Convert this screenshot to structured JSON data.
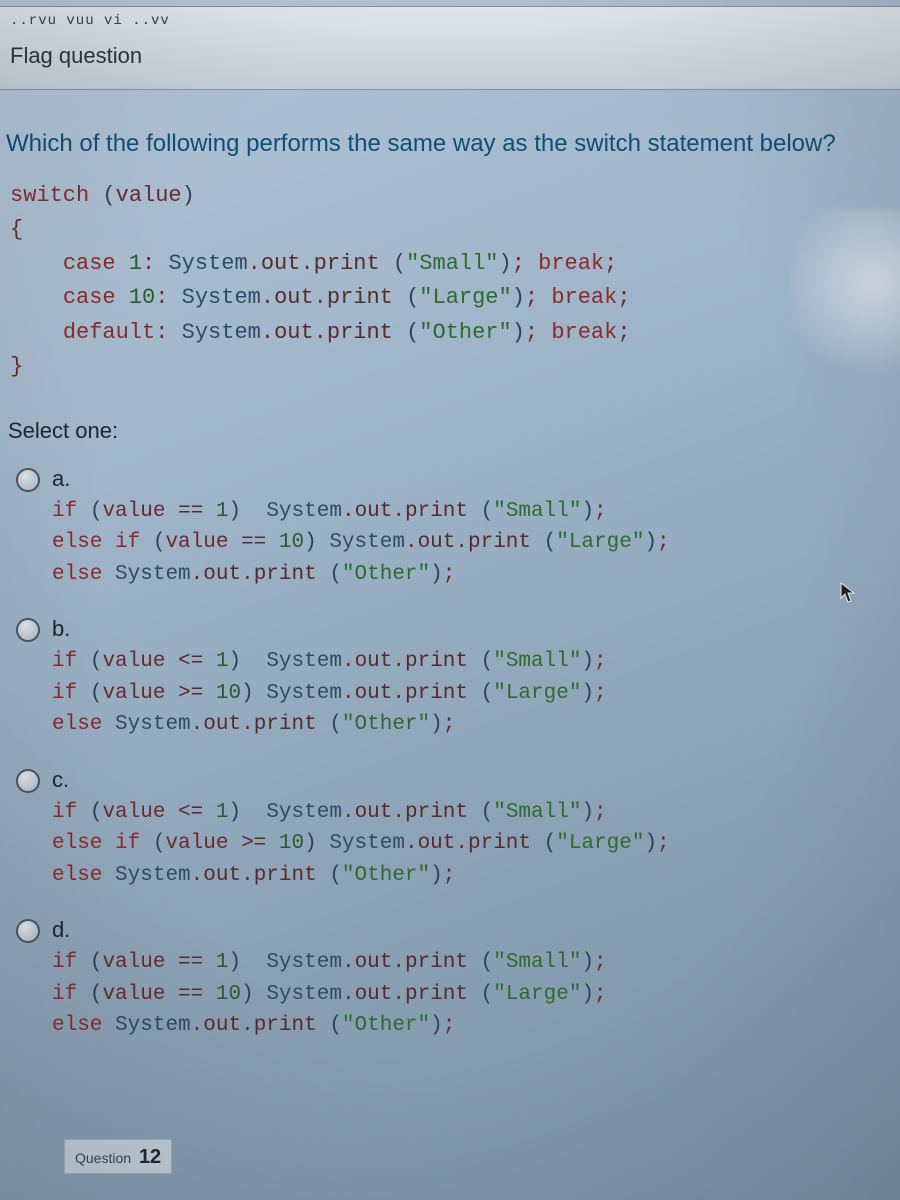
{
  "top_partial": "..rvu vuu vi ..vv",
  "flag_label": "Flag question",
  "question_text": "Which of the following performs the same way as the switch statement below?",
  "code": {
    "l1": {
      "kw": "switch",
      "sp": " ",
      "po": "(",
      "id": "value",
      "pc": ")"
    },
    "l2": "{",
    "l3": {
      "indent": "    ",
      "kw": "case",
      "sp": " ",
      "n": "1",
      "col": ": ",
      "cls": "System",
      "dot1": ".",
      "out": "out",
      "dot2": ".",
      "prn": "print",
      "sp2": " ",
      "po": "(",
      "str": "\"Small\"",
      "pc": ")",
      "semi": "; ",
      "brk": "break",
      "semi2": ";"
    },
    "l4": {
      "indent": "    ",
      "kw": "case",
      "sp": " ",
      "n": "10",
      "col": ": ",
      "cls": "System",
      "dot1": ".",
      "out": "out",
      "dot2": ".",
      "prn": "print",
      "sp2": " ",
      "po": "(",
      "str": "\"Large\"",
      "pc": ")",
      "semi": "; ",
      "brk": "break",
      "semi2": ";"
    },
    "l5": {
      "indent": "    ",
      "kw": "default",
      "col": ": ",
      "cls": "System",
      "dot1": ".",
      "out": "out",
      "dot2": ".",
      "prn": "print",
      "sp2": " ",
      "po": "(",
      "str": "\"Other\"",
      "pc": ")",
      "semi": "; ",
      "brk": "break",
      "semi2": ";"
    },
    "l6": "}"
  },
  "select_one": "Select one:",
  "options": {
    "a": {
      "letter": "a.",
      "l1": {
        "kw": "if",
        "sp": " ",
        "po": "(",
        "id": "value",
        "sp2": " ",
        "op": "==",
        "sp3": " ",
        "n": "1",
        "pc": ")",
        "gap": "  ",
        "cls": "System",
        "dot1": ".",
        "out": "out",
        "dot2": ".",
        "prn": "print",
        "sp4": " ",
        "po2": "(",
        "str": "\"Small\"",
        "pc2": ")",
        "semi": ";"
      },
      "l2": {
        "kw": "else if",
        "sp": " ",
        "po": "(",
        "id": "value",
        "sp2": " ",
        "op": "==",
        "sp3": " ",
        "n": "10",
        "pc": ")",
        "gap": " ",
        "cls": "System",
        "dot1": ".",
        "out": "out",
        "dot2": ".",
        "prn": "print",
        "sp4": " ",
        "po2": "(",
        "str": "\"Large\"",
        "pc2": ")",
        "semi": ";"
      },
      "l3": {
        "kw": "else",
        "sp": " ",
        "cls": "System",
        "dot1": ".",
        "out": "out",
        "dot2": ".",
        "prn": "print",
        "sp4": " ",
        "po2": "(",
        "str": "\"Other\"",
        "pc2": ")",
        "semi": ";"
      }
    },
    "b": {
      "letter": "b.",
      "l1": {
        "kw": "if",
        "sp": " ",
        "po": "(",
        "id": "value",
        "sp2": " ",
        "op": "<=",
        "sp3": " ",
        "n": "1",
        "pc": ")",
        "gap": "  ",
        "cls": "System",
        "dot1": ".",
        "out": "out",
        "dot2": ".",
        "prn": "print",
        "sp4": " ",
        "po2": "(",
        "str": "\"Small\"",
        "pc2": ")",
        "semi": ";"
      },
      "l2": {
        "kw": "if",
        "sp": " ",
        "po": "(",
        "id": "value",
        "sp2": " ",
        "op": ">=",
        "sp3": " ",
        "n": "10",
        "pc": ")",
        "gap": " ",
        "cls": "System",
        "dot1": ".",
        "out": "out",
        "dot2": ".",
        "prn": "print",
        "sp4": " ",
        "po2": "(",
        "str": "\"Large\"",
        "pc2": ")",
        "semi": ";"
      },
      "l3": {
        "kw": "else",
        "sp": " ",
        "cls": "System",
        "dot1": ".",
        "out": "out",
        "dot2": ".",
        "prn": "print",
        "sp4": " ",
        "po2": "(",
        "str": "\"Other\"",
        "pc2": ")",
        "semi": ";"
      }
    },
    "c": {
      "letter": "c.",
      "l1": {
        "kw": "if",
        "sp": " ",
        "po": "(",
        "id": "value",
        "sp2": " ",
        "op": "<=",
        "sp3": " ",
        "n": "1",
        "pc": ")",
        "gap": "  ",
        "cls": "System",
        "dot1": ".",
        "out": "out",
        "dot2": ".",
        "prn": "print",
        "sp4": " ",
        "po2": "(",
        "str": "\"Small\"",
        "pc2": ")",
        "semi": ";"
      },
      "l2": {
        "kw": "else if",
        "sp": " ",
        "po": "(",
        "id": "value",
        "sp2": " ",
        "op": ">=",
        "sp3": " ",
        "n": "10",
        "pc": ")",
        "gap": " ",
        "cls": "System",
        "dot1": ".",
        "out": "out",
        "dot2": ".",
        "prn": "print",
        "sp4": " ",
        "po2": "(",
        "str": "\"Large\"",
        "pc2": ")",
        "semi": ";"
      },
      "l3": {
        "kw": "else",
        "sp": " ",
        "cls": "System",
        "dot1": ".",
        "out": "out",
        "dot2": ".",
        "prn": "print",
        "sp4": " ",
        "po2": "(",
        "str": "\"Other\"",
        "pc2": ")",
        "semi": ";"
      }
    },
    "d": {
      "letter": "d.",
      "l1": {
        "kw": "if",
        "sp": " ",
        "po": "(",
        "id": "value",
        "sp2": " ",
        "op": "==",
        "sp3": " ",
        "n": "1",
        "pc": ")",
        "gap": "  ",
        "cls": "System",
        "dot1": ".",
        "out": "out",
        "dot2": ".",
        "prn": "print",
        "sp4": " ",
        "po2": "(",
        "str": "\"Small\"",
        "pc2": ")",
        "semi": ";"
      },
      "l2": {
        "kw": "if",
        "sp": " ",
        "po": "(",
        "id": "value",
        "sp2": " ",
        "op": "==",
        "sp3": " ",
        "n": "10",
        "pc": ")",
        "gap": " ",
        "cls": "System",
        "dot1": ".",
        "out": "out",
        "dot2": ".",
        "prn": "print",
        "sp4": " ",
        "po2": "(",
        "str": "\"Large\"",
        "pc2": ")",
        "semi": ";"
      },
      "l3": {
        "kw": "else",
        "sp": " ",
        "cls": "System",
        "dot1": ".",
        "out": "out",
        "dot2": ".",
        "prn": "print",
        "sp4": " ",
        "po2": "(",
        "str": "\"Other\"",
        "pc2": ")",
        "semi": ";"
      }
    }
  },
  "footer": {
    "label": "Question",
    "num": "12"
  }
}
